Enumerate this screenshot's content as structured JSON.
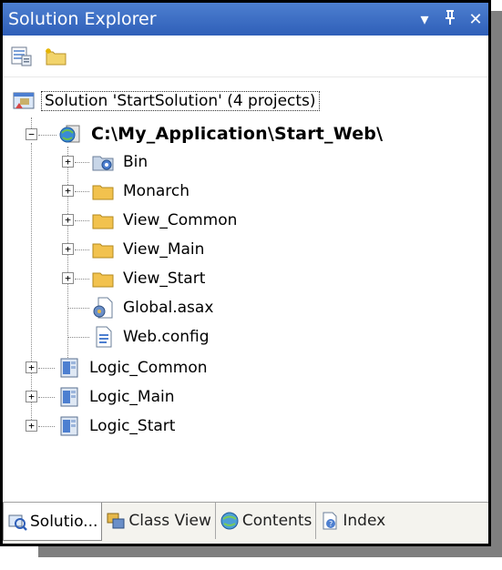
{
  "window": {
    "title": "Solution Explorer",
    "buttons": {
      "dropdown": "▾",
      "pin": "ᵻ",
      "close": "✕"
    }
  },
  "toolbar": {
    "buttons": [
      {
        "icon": "properties-icon"
      },
      {
        "icon": "show-all-files-icon"
      }
    ]
  },
  "tree": {
    "solution": {
      "label": "Solution 'StartSolution' (4 projects)",
      "icon": "solution-icon"
    },
    "web_project": {
      "label": "C:\\My_Application\\Start_Web\\",
      "icon": "web-project-icon",
      "expanded": true
    },
    "web_children": [
      {
        "label": "Bin",
        "icon": "bin-folder-icon",
        "expandable": true
      },
      {
        "label": "Monarch",
        "icon": "folder-icon",
        "expandable": true
      },
      {
        "label": "View_Common",
        "icon": "folder-icon",
        "expandable": true
      },
      {
        "label": "View_Main",
        "icon": "folder-icon",
        "expandable": true
      },
      {
        "label": "View_Start",
        "icon": "folder-icon",
        "expandable": true
      },
      {
        "label": "Global.asax",
        "icon": "asax-file-icon",
        "expandable": false
      },
      {
        "label": "Web.config",
        "icon": "config-file-icon",
        "expandable": false
      }
    ],
    "projects": [
      {
        "label": "Logic_Common",
        "icon": "class-library-icon"
      },
      {
        "label": "Logic_Main",
        "icon": "class-library-icon"
      },
      {
        "label": "Logic_Start",
        "icon": "class-library-icon"
      }
    ]
  },
  "tabs": [
    {
      "label": "Solutio...",
      "icon": "solution-explorer-icon",
      "active": true
    },
    {
      "label": "Class View",
      "icon": "class-view-icon",
      "active": false
    },
    {
      "label": "Contents",
      "icon": "contents-icon",
      "active": false
    },
    {
      "label": "Index",
      "icon": "index-icon",
      "active": false
    }
  ],
  "colors": {
    "titlebar": "#3a6cc4",
    "folder": "#f2c24e",
    "selection_border": "#333333"
  }
}
